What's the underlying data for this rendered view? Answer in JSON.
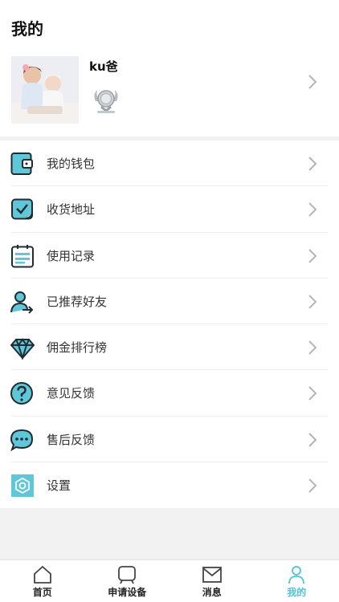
{
  "page_title": "我的",
  "profile": {
    "username": "ku爸",
    "avatar_icon": "baby-photo-avatar",
    "medal_icon": "silver-medal-icon"
  },
  "menu": [
    {
      "label": "我的钱包",
      "icon": "wallet-icon"
    },
    {
      "label": "收货地址",
      "icon": "address-check-icon"
    },
    {
      "label": "使用记录",
      "icon": "usage-record-icon"
    },
    {
      "label": "已推荐好友",
      "icon": "referred-friend-icon"
    },
    {
      "label": "佣金排行榜",
      "icon": "diamond-icon"
    },
    {
      "label": "意见反馈",
      "icon": "question-icon"
    },
    {
      "label": "售后反馈",
      "icon": "chat-icon"
    },
    {
      "label": "设置",
      "icon": "settings-icon"
    }
  ],
  "tabbar": [
    {
      "label": "首页",
      "icon": "home-icon",
      "active": false
    },
    {
      "label": "申请设备",
      "icon": "device-icon",
      "active": false
    },
    {
      "label": "消息",
      "icon": "mail-icon",
      "active": false
    },
    {
      "label": "我的",
      "icon": "person-icon",
      "active": true
    }
  ],
  "colors": {
    "accent": "#4fc3d9",
    "icon_dark": "#1f2d33"
  }
}
